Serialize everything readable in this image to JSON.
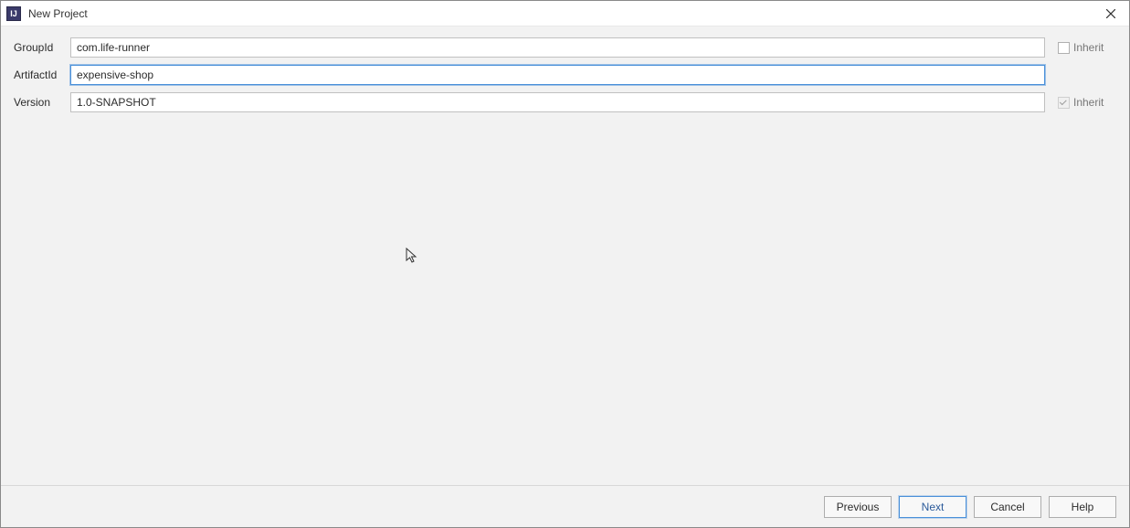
{
  "window": {
    "title": "New Project"
  },
  "form": {
    "groupId": {
      "label": "GroupId",
      "value": "com.life-runner",
      "inherit_label": "Inherit",
      "inherit_checked": false
    },
    "artifactId": {
      "label": "ArtifactId",
      "value": "expensive-shop"
    },
    "version": {
      "label": "Version",
      "value": "1.0-SNAPSHOT",
      "inherit_label": "Inherit",
      "inherit_checked": true
    }
  },
  "buttons": {
    "previous": "Previous",
    "next": "Next",
    "cancel": "Cancel",
    "help": "Help"
  }
}
